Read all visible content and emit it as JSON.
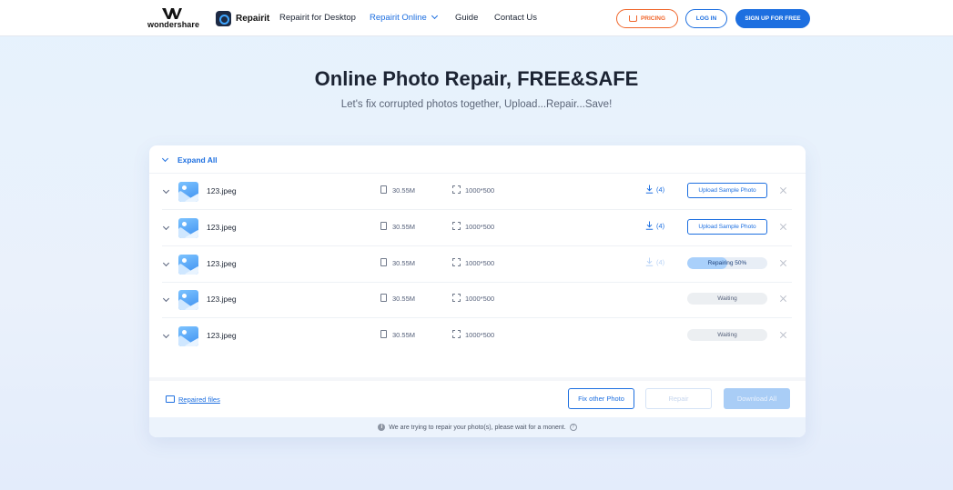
{
  "header": {
    "brand": "wondershare",
    "product": "Repairit",
    "nav": [
      {
        "label": "Repairit for Desktop"
      },
      {
        "label": "Repairit Online"
      },
      {
        "label": "Guide"
      },
      {
        "label": "Contact Us"
      }
    ],
    "pricing_label": "PRICING",
    "login_label": "LOG IN",
    "signup_label": "SIGN UP FOR FREE"
  },
  "hero": {
    "title": "Online Photo Repair, FREE&SAFE",
    "subtitle": "Let's fix corrupted photos together, Upload...Repair...Save!"
  },
  "panel": {
    "expand_all": "Expand All",
    "files": [
      {
        "name": "123.jpeg",
        "size": "30.55M",
        "dimensions": "1000*500",
        "downloads": "(4)",
        "status": "upload",
        "action_label": "Upload Sample Photo"
      },
      {
        "name": "123.jpeg",
        "size": "30.55M",
        "dimensions": "1000*500",
        "downloads": "(4)",
        "status": "upload",
        "action_label": "Upload Sample Photo"
      },
      {
        "name": "123.jpeg",
        "size": "30.55M",
        "dimensions": "1000*500",
        "downloads": "(4)",
        "status": "repairing",
        "action_label": "Repairing 50%",
        "progress": 0.5
      },
      {
        "name": "123.jpeg",
        "size": "30.55M",
        "dimensions": "1000*500",
        "status": "waiting",
        "action_label": "Waiting"
      },
      {
        "name": "123.jpeg",
        "size": "30.55M",
        "dimensions": "1000*500",
        "status": "waiting",
        "action_label": "Waiting"
      }
    ],
    "repaired_files": "Repaired files",
    "fix_other": "Fix other Photo",
    "repair": "Repair",
    "download_all": "Download All",
    "notice": "We are trying to repair your photo(s), please wait for a monent."
  },
  "colors": {
    "accent": "#1d6fe0",
    "pricing": "#f0662b"
  }
}
